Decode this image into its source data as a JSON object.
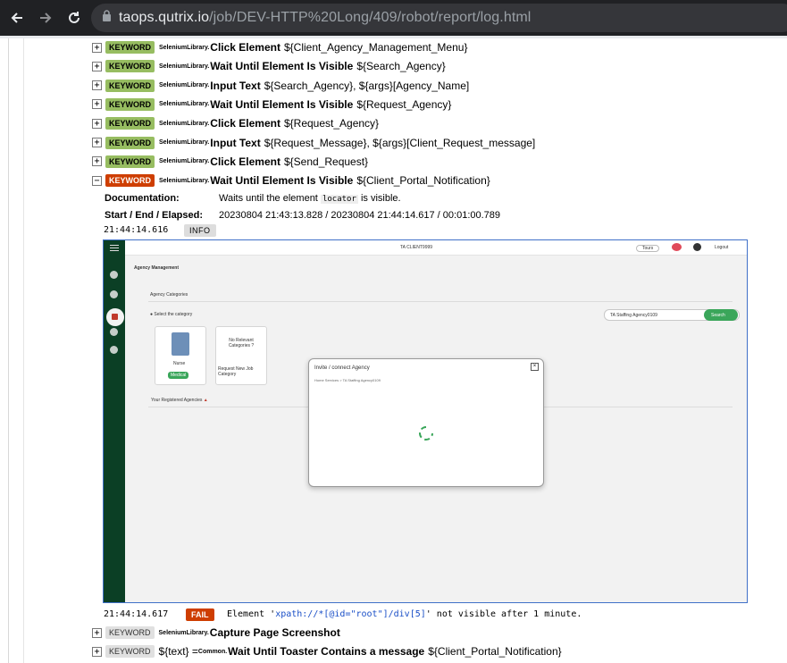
{
  "browser": {
    "url_host": "taops.qutrix.io",
    "url_path": "/job/DEV-HTTP%20Long/409/robot/report/log.html"
  },
  "keywords": [
    {
      "toggle": "+",
      "badge": "KEYWORD",
      "status": "pass",
      "lib": "SeleniumLibrary.",
      "name": "Click Element",
      "args": "${Client_Agency_Management_Menu}"
    },
    {
      "toggle": "+",
      "badge": "KEYWORD",
      "status": "pass",
      "lib": "SeleniumLibrary.",
      "name": "Wait Until Element Is Visible",
      "args": "${Search_Agency}"
    },
    {
      "toggle": "+",
      "badge": "KEYWORD",
      "status": "pass",
      "lib": "SeleniumLibrary.",
      "name": "Input Text",
      "args": "${Search_Agency}, ${args}[Agency_Name]"
    },
    {
      "toggle": "+",
      "badge": "KEYWORD",
      "status": "pass",
      "lib": "SeleniumLibrary.",
      "name": "Wait Until Element Is Visible",
      "args": "${Request_Agency}"
    },
    {
      "toggle": "+",
      "badge": "KEYWORD",
      "status": "pass",
      "lib": "SeleniumLibrary.",
      "name": "Click Element",
      "args": "${Request_Agency}"
    },
    {
      "toggle": "+",
      "badge": "KEYWORD",
      "status": "pass",
      "lib": "SeleniumLibrary.",
      "name": "Input Text",
      "args": "${Request_Message}, ${args}[Client_Request_message]"
    },
    {
      "toggle": "+",
      "badge": "KEYWORD",
      "status": "pass",
      "lib": "SeleniumLibrary.",
      "name": "Click Element",
      "args": "${Send_Request}"
    },
    {
      "toggle": "−",
      "badge": "KEYWORD",
      "status": "fail",
      "lib": "SeleniumLibrary.",
      "name": "Wait Until Element Is Visible",
      "args": "${Client_Portal_Notification}"
    }
  ],
  "details": {
    "doc_label": "Documentation:",
    "doc_pre": "Waits until the element",
    "doc_code": "locator",
    "doc_post": "is visible.",
    "time_label": "Start / End / Elapsed:",
    "time_value": "20230804 21:43:13.828 / 20230804 21:44:14.617 / 00:01:00.789"
  },
  "info_msg": {
    "timestamp": "21:44:14.616",
    "level": "INFO"
  },
  "fail_msg": {
    "timestamp": "21:44:14.617",
    "level": "FAIL",
    "pre": "Element '",
    "xpath": "xpath://*[@id=\"root\"]/div[5]",
    "post": "' not visible after 1 minute."
  },
  "after": [
    {
      "toggle": "+",
      "badge": "KEYWORD",
      "lib": "SeleniumLibrary.",
      "name": "Capture Page Screenshot",
      "args": ""
    },
    {
      "toggle": "+",
      "badge": "KEYWORD",
      "assign": "${text} = ",
      "lib": "Common.",
      "name": "Wait Until Toaster Contains a message",
      "args": "${Client_Portal_Notification}"
    }
  ],
  "screenshot": {
    "header_title": "TA CLIENT9999",
    "page_title": "Agency Management",
    "section": "Agency Categories",
    "select_hint": "Select the category",
    "search_value": "TA Staffing Agency0109",
    "search_btn": "Search",
    "card1_label": "Nurse",
    "card1_btn": "Medical",
    "card2_title": "No Relevant Categories ?",
    "card2_link": "Request New Job Category",
    "registered": "Your Registered Agencies",
    "modal_title": "Invite / connect Agency",
    "modal_crumb": "Home Services > TA Staffing Agency0109",
    "header_right": "Logout",
    "header_pill": "Tours"
  },
  "colors": {
    "pass": "#97bd61",
    "fail": "#ce3e01",
    "sidebar": "#0b3f25",
    "accent": "#3aa65a"
  }
}
